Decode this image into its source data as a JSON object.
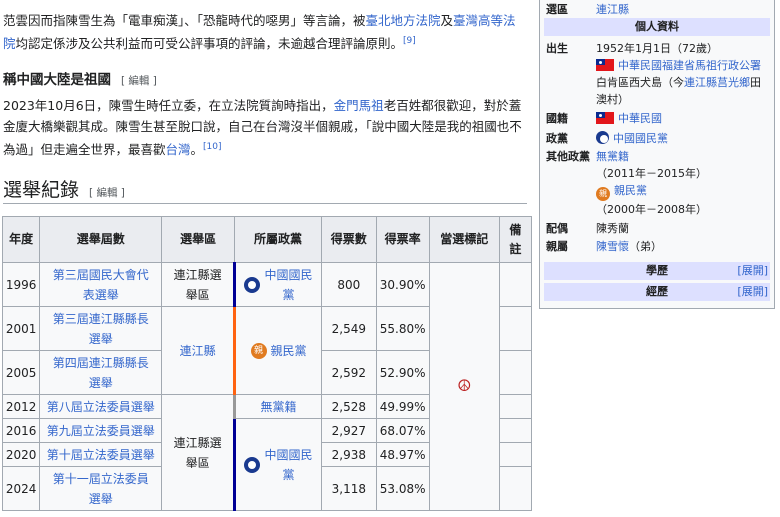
{
  "intro": {
    "p1_a": "范雲因而指陳雪生為「電車痴漢」、「恐龍時代的噁男」等言論，被",
    "p1_link1": "臺北地方法院",
    "p1_b": "及",
    "p1_link2": "臺灣高等法院",
    "p1_c": "均認定係涉及公共利益而可受公評事項的評論，未逾越合理評論原則。",
    "p1_ref": "[9]"
  },
  "section1": {
    "title": "稱中國大陸是祖國",
    "edit": "[ 編輯 ]",
    "p_a": "2023年10月6日，陳雪生時任立委，在立法院質詢時指出，",
    "p_link1": "金門馬祖",
    "p_b": "老百姓都很歡迎，對於蓋金廈大橋樂觀其成。陳雪生甚至脫口說，自己在台灣沒半個親戚，「說中國大陸是我的祖國也不為過」但走遍全世界，最喜歡",
    "p_link2": "台灣",
    "p_c": "。",
    "p_ref": "[10]"
  },
  "section2": {
    "title": "選舉紀錄",
    "edit": "[ 編輯 ]"
  },
  "table": {
    "headers": [
      "年度",
      "選舉屆數",
      "選舉區",
      "所屬政黨",
      "得票數",
      "得票率",
      "當選標記",
      "備註"
    ],
    "rows": [
      {
        "year": "1996",
        "election": "第三屆國民大會代表選舉",
        "votes": "800",
        "pct": "30.90%"
      },
      {
        "year": "2001",
        "election": "第三屆連江縣縣長選舉",
        "votes": "2,549",
        "pct": "55.80%"
      },
      {
        "year": "2005",
        "election": "第四屆連江縣縣長選舉",
        "votes": "2,592",
        "pct": "52.90%"
      },
      {
        "year": "2012",
        "election": "第八屆立法委員選舉",
        "votes": "2,528",
        "pct": "49.99%"
      },
      {
        "year": "2016",
        "election": "第九屆立法委員選舉",
        "votes": "2,927",
        "pct": "68.07%"
      },
      {
        "year": "2020",
        "election": "第十屆立法委員選舉",
        "votes": "2,938",
        "pct": "48.97%"
      },
      {
        "year": "2024",
        "election": "第十一屆立法委員選舉",
        "votes": "3,118",
        "pct": "53.08%"
      }
    ],
    "district_a": "連江縣選舉區",
    "district_b": "連江縣",
    "district_c": "連江縣選舉區",
    "party_kmt": "中國國民黨",
    "party_pfp": "親民黨",
    "party_np": "無黨籍",
    "pfp_glyph": "親",
    "elected_mark": "☮"
  },
  "infobox": {
    "district_label": "選區",
    "district_value": "連江縣",
    "personal_header": "個人資料",
    "born_label": "出生",
    "born_line1": "1952年1月1日（72歲）",
    "born_link": "中華民國福建省馬祖行政公署",
    "born_line2": "白肯區西犬島（今",
    "born_link2": "連江縣莒光鄉",
    "born_line3": "田澳村）",
    "nationality_label": "國籍",
    "nationality_value": "中華民國",
    "party_label": "政黨",
    "party_value": "中國國民黨",
    "other_label": "其他政黨",
    "other_np": "無黨籍",
    "other_np_years": "（2011年－2015年）",
    "other_pfp": "親民黨",
    "other_pfp_years": "（2000年－2008年）",
    "spouse_label": "配偶",
    "spouse_value": "陳秀蘭",
    "relatives_label": "親屬",
    "relatives_link": "陳雪懷",
    "relatives_rel": "（弟）",
    "education_header": "學歷",
    "career_header": "經歷",
    "expand": "[展開]"
  }
}
